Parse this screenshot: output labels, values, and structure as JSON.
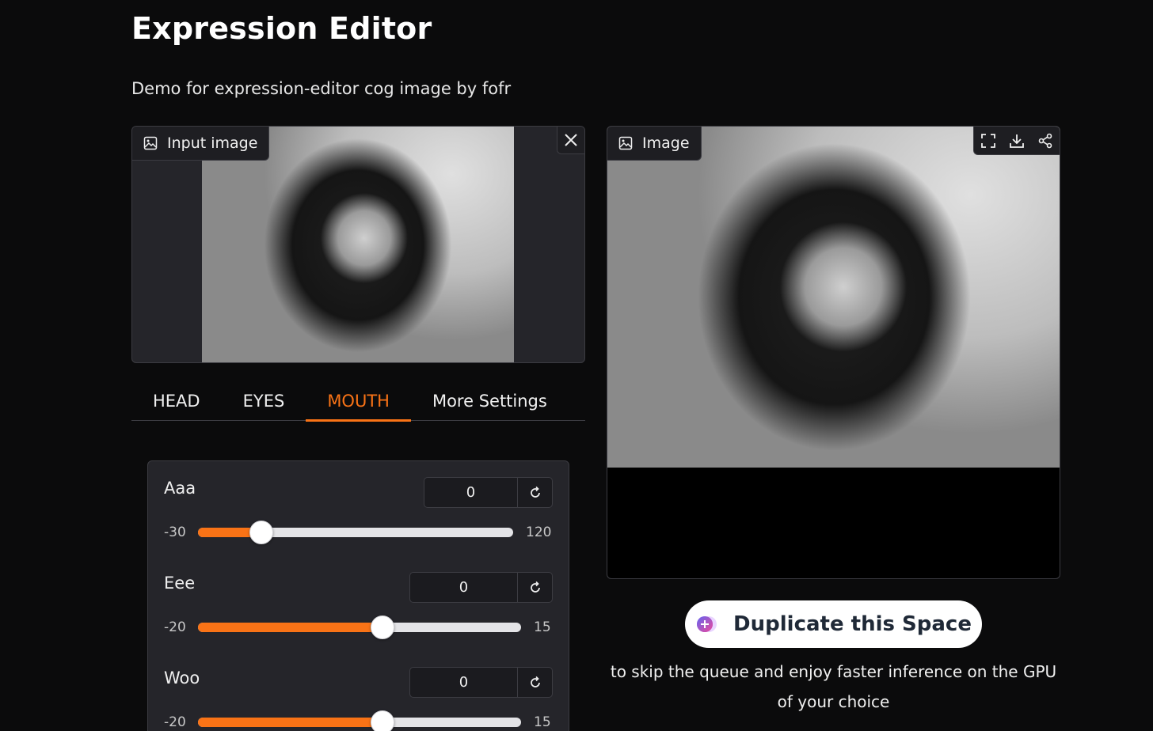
{
  "page": {
    "title": "Expression Editor",
    "subtitle": "Demo for expression-editor cog image by fofr"
  },
  "input_panel": {
    "label": "Input image",
    "icon": "image-icon",
    "close_icon": "close-icon"
  },
  "output_panel": {
    "label": "Image",
    "icon": "image-icon",
    "toolbar": [
      "fullscreen-icon",
      "download-icon",
      "share-icon"
    ]
  },
  "tabs": [
    {
      "label": "HEAD",
      "active": false
    },
    {
      "label": "EYES",
      "active": false
    },
    {
      "label": "MOUTH",
      "active": true
    },
    {
      "label": "More Settings",
      "active": false
    }
  ],
  "sliders": [
    {
      "label": "Aaa",
      "value": "0",
      "min": "-30",
      "max": "120",
      "fraction": 0.2
    },
    {
      "label": "Eee",
      "value": "0",
      "min": "-20",
      "max": "15",
      "fraction": 0.571
    },
    {
      "label": "Woo",
      "value": "0",
      "min": "-20",
      "max": "15",
      "fraction": 0.571
    }
  ],
  "duplicate": {
    "button_label": "Duplicate this Space",
    "note": "to skip the queue and enjoy faster inference on the GPU of your choice"
  },
  "colors": {
    "accent": "#f97316",
    "background": "#0b0b0c",
    "panel": "#25252a"
  }
}
